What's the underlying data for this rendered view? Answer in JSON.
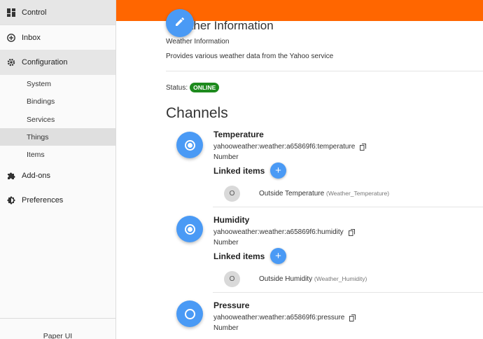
{
  "sidebar": {
    "control": "Control",
    "inbox": "Inbox",
    "configuration": "Configuration",
    "config_items": [
      "System",
      "Bindings",
      "Services",
      "Things",
      "Items"
    ],
    "addons": "Add-ons",
    "preferences": "Preferences",
    "footer": "Paper UI"
  },
  "thing": {
    "title": "Weather Information",
    "label": "Weather Information",
    "description": "Provides various weather data from the Yahoo service",
    "status_label": "Status:",
    "status": "ONLINE"
  },
  "channels_heading": "Channels",
  "linked_items_label": "Linked items",
  "channels": [
    {
      "name": "Temperature",
      "uid": "yahooweather:weather:a65869f6:temperature",
      "type": "Number",
      "linked_item_initial": "O",
      "linked_item_name": "Outside Temperature",
      "linked_item_id": "(Weather_Temperature)"
    },
    {
      "name": "Humidity",
      "uid": "yahooweather:weather:a65869f6:humidity",
      "type": "Number",
      "linked_item_initial": "O",
      "linked_item_name": "Outside Humidity",
      "linked_item_id": "(Weather_Humidity)"
    },
    {
      "name": "Pressure",
      "uid": "yahooweather:weather:a65869f6:pressure",
      "type": "Number"
    }
  ],
  "colors": {
    "header": "#ff6600",
    "accent": "#4a9af5",
    "online": "#1d8a1d"
  }
}
